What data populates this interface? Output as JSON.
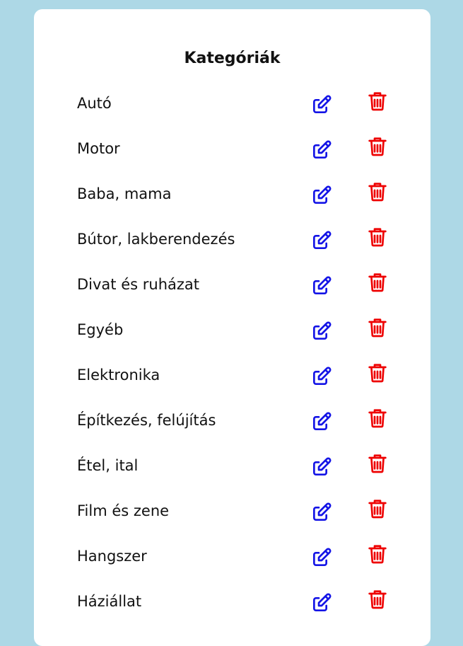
{
  "title": "Kategóriák",
  "colors": {
    "background": "#add8e6",
    "card": "#ffffff",
    "edit_icon": "#1414e6",
    "delete_icon": "#ee0000"
  },
  "icons": {
    "edit": "edit-icon",
    "delete": "trash-icon"
  },
  "categories": [
    "Autó",
    "Motor",
    "Baba, mama",
    "Bútor, lakberendezés",
    "Divat és ruházat",
    "Egyéb",
    "Elektronika",
    "Építkezés, felújítás",
    "Étel, ital",
    "Film és zene",
    "Hangszer",
    "Háziállat"
  ]
}
